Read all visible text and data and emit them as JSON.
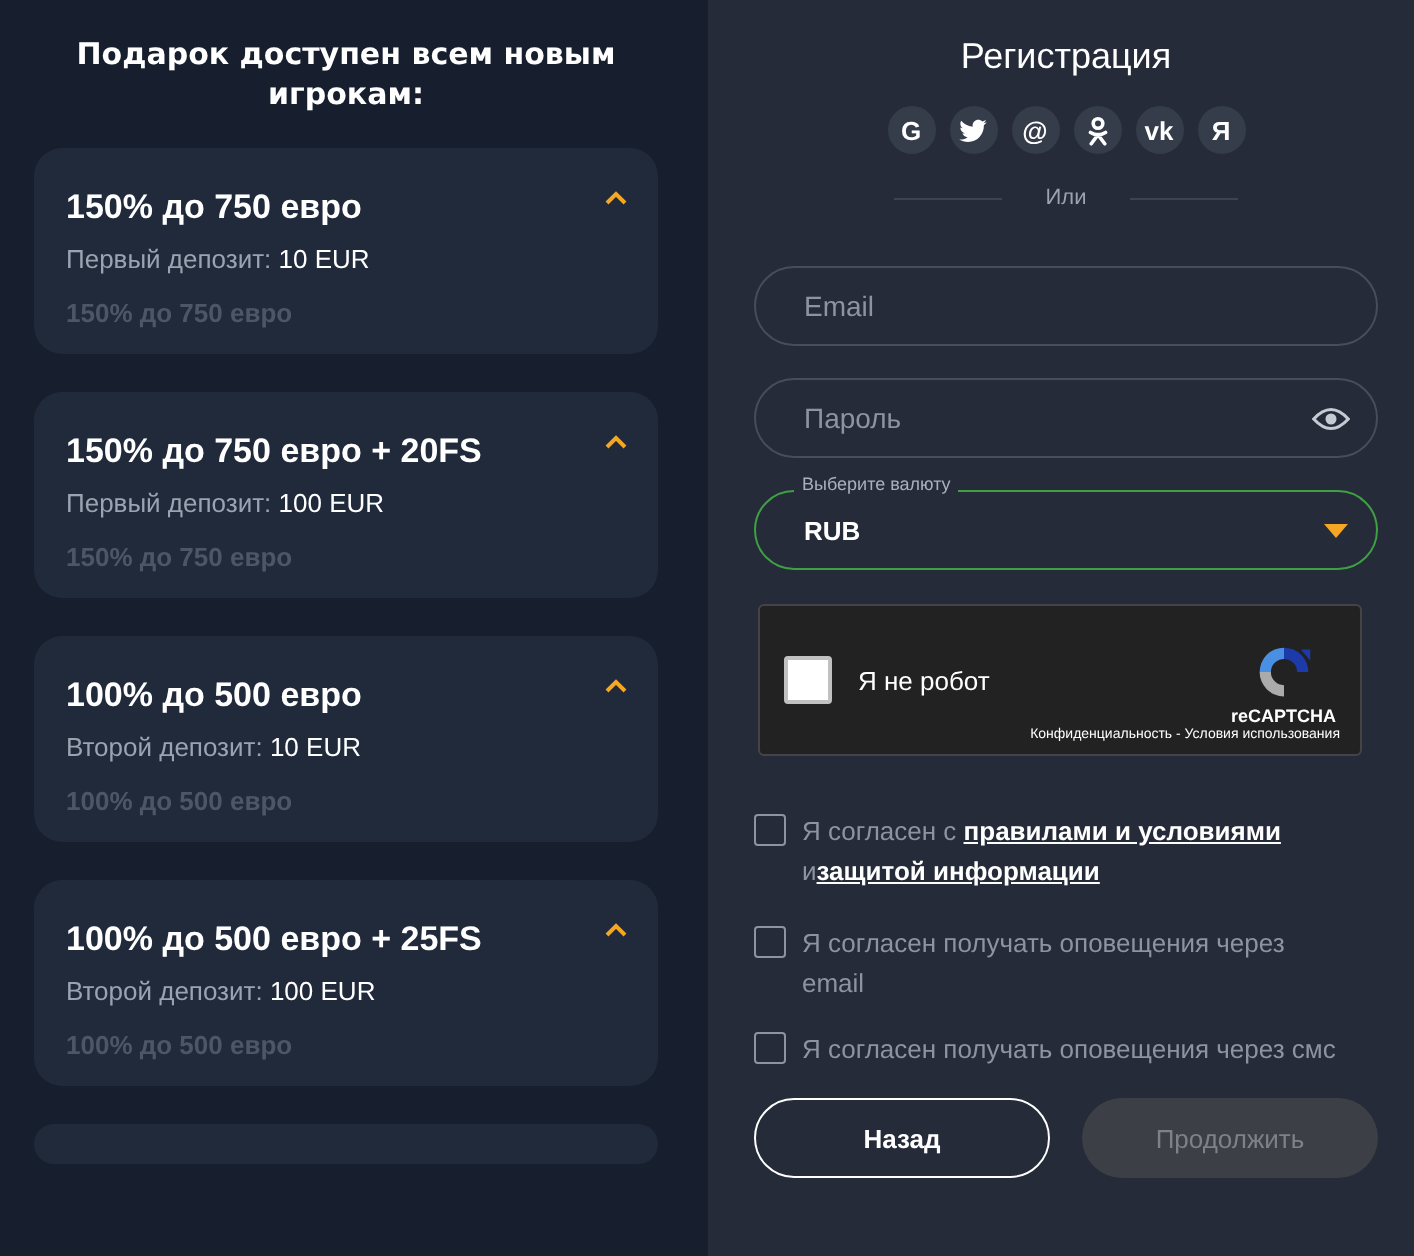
{
  "promo": {
    "heading": "Подарок доступен всем новым игрокам:",
    "cards": [
      {
        "title": "150% до 750 евро",
        "subtitle": "Первый депозит: **10 EUR**",
        "preview": "150% до 750 евро",
        "expanded": true
      },
      {
        "title": "150% до 750 евро + 20FS",
        "subtitle": "Первый депозит: **100 EUR**",
        "preview": "150% до 750 евро",
        "expanded": true
      },
      {
        "title": "100% до 500 евро",
        "subtitle": "Второй депозит: **10 EUR**",
        "preview": "100% до 500 евро",
        "expanded": true
      },
      {
        "title": "100% до 500 евро + 25FS",
        "subtitle": "Второй депозит: **100 EUR**",
        "preview": "100% до 500 евро",
        "expanded": true
      }
    ]
  },
  "registration": {
    "title": "Регистрация",
    "socials": [
      {
        "kind": "glyph",
        "label": "G"
      },
      {
        "kind": "bird"
      },
      {
        "kind": "glyph",
        "label": "@"
      },
      {
        "kind": "ok"
      },
      {
        "kind": "glyph",
        "label": "vk"
      },
      {
        "kind": "glyph",
        "label": "Я"
      }
    ],
    "divider": "Или",
    "email": {
      "placeholder": "Email"
    },
    "password": {
      "placeholder": "Пароль"
    },
    "currency": {
      "label": "Выберите валюту",
      "value": "RUB"
    },
    "captcha": {
      "checked": false,
      "label": "Я не робот",
      "brand": "reCAPTCHA",
      "links": "Конфиденциальность - Условия использования"
    },
    "agreements": [
      {
        "checked": false,
        "parts": [
          {
            "text": "Я согласен с "
          },
          {
            "text": "правилами и условиями",
            "link": true
          },
          {
            "text": " и"
          },
          {
            "text": "защитой информации",
            "link": true
          }
        ]
      },
      {
        "checked": false,
        "parts": [
          {
            "text": "Я согласен получать оповещения через email"
          }
        ]
      },
      {
        "checked": false,
        "parts": [
          {
            "text": "Я согласен получать оповещения через смс"
          }
        ]
      }
    ],
    "buttons": [
      {
        "label": "Назад",
        "kind": "outline"
      },
      {
        "label": "Продолжить",
        "kind": "disabled"
      }
    ]
  }
}
